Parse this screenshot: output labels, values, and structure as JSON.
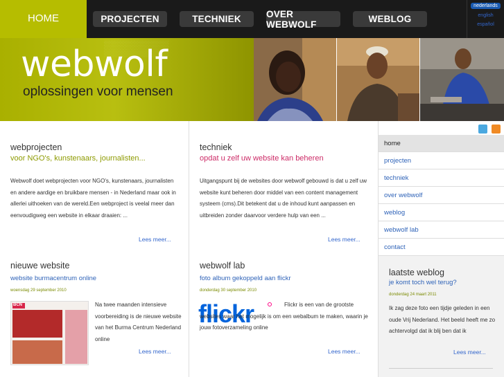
{
  "nav": {
    "home": "HOME",
    "items": [
      "PROJECTEN",
      "TECHNIEK",
      "OVER WEBWOLF",
      "WEBLOG"
    ],
    "languages": [
      "nederlands",
      "english",
      "español"
    ]
  },
  "banner": {
    "logo": "webwolf",
    "tagline": "oplossingen voor mensen"
  },
  "col1": {
    "section1": {
      "title": "webprojecten",
      "subtitle": "voor NGO's, kunstenaars, journalisten...",
      "body": "Webwolf doet webprojecten voor NGO's, kunstenaars, journalisten en andere aardige en bruikbare mensen - in Nederland maar ook in allerlei uithoeken van de wereld.Een webproject is veelal meer dan eenvoudigweg een website in elkaar draaien: ...",
      "more": "Lees meer..."
    },
    "section2": {
      "title": "nieuwe website",
      "subtitle": "website burmacentrum online",
      "date": "woensdag 29 september 2010",
      "body": "Na twee maanden intensieve voorbereiding is de nieuwe website van het Burma Centrum Nederland online",
      "more": "Lees meer...",
      "thumb_label": "BCN"
    }
  },
  "col2": {
    "section1": {
      "title": "techniek",
      "subtitle": "opdat u zelf uw website kan beheren",
      "body": "Uitgangspunt bij de websites door webwolf gebouwd is dat u zelf uw website kunt beheren door middel van een content management systeem (cms).Dit betekent dat u de inhoud kunt aanpassen en uitbreiden zonder daarvoor verdere hulp van een ...",
      "more": "Lees meer..."
    },
    "section2": {
      "title": "webwolf lab",
      "subtitle": "foto album gekoppeld aan flickr",
      "date": "donderdag 30 september 2010",
      "body": "Flickr is een van de grootste websites waar het mogelijk is om een webalbum te maken, waarin je jouw fotoverzameling online",
      "more": "Lees meer...",
      "logo": "flickr"
    }
  },
  "sidebar": {
    "menu": [
      "home",
      "projecten",
      "techniek",
      "over webwolf",
      "weblog",
      "webwolf lab",
      "contact"
    ],
    "weblog": {
      "title": "laatste weblog",
      "subtitle": "je komt toch wel terug?",
      "date": "donderdag 24 maart 2011",
      "body": "Ik zag deze foto een tijdje geleden in een oude Vrij Nederland. Het beeld heeft me zo achtervolgd dat ik blij ben dat ik",
      "more": "Lees meer..."
    }
  },
  "colors": {
    "accent": "#b6bd00",
    "link": "#2f63b8",
    "pink": "#cc2a66"
  }
}
